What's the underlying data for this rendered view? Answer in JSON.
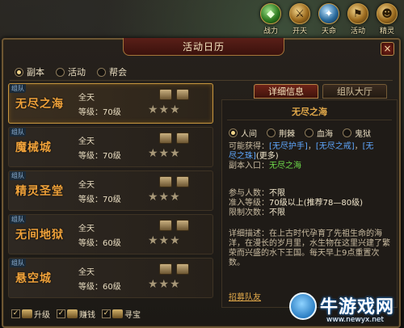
{
  "hud": [
    {
      "label": "战力",
      "icon": "power-icon",
      "glyph": "◆",
      "style": "green"
    },
    {
      "label": "开天",
      "icon": "kaitian-icon",
      "glyph": "⚔",
      "style": ""
    },
    {
      "label": "天命",
      "icon": "destiny-icon",
      "glyph": "✦",
      "style": "blue"
    },
    {
      "label": "活动",
      "icon": "activity-icon",
      "glyph": "⚑",
      "style": ""
    },
    {
      "label": "精灵",
      "icon": "spirit-icon",
      "glyph": "☻",
      "style": ""
    }
  ],
  "window": {
    "title": "活动日历",
    "close": "×"
  },
  "categories": [
    {
      "label": "副本",
      "selected": true
    },
    {
      "label": "活动",
      "selected": false
    },
    {
      "label": "帮会",
      "selected": false
    }
  ],
  "list": [
    {
      "tag": "组队",
      "name": "无尽之海",
      "time": "全天",
      "level": "等级：70级",
      "stars": "★★★",
      "selected": true
    },
    {
      "tag": "组队",
      "name": "魔械城",
      "time": "全天",
      "level": "等级：70级",
      "stars": "★★★",
      "selected": false
    },
    {
      "tag": "组队",
      "name": "精灵圣堂",
      "time": "全天",
      "level": "等级：70级",
      "stars": "★★★",
      "selected": false
    },
    {
      "tag": "组队",
      "name": "无间地狱",
      "time": "全天",
      "level": "等级：60级",
      "stars": "★★★",
      "selected": false
    },
    {
      "tag": "组队",
      "name": "悬空城",
      "time": "全天",
      "level": "等级：60级",
      "stars": "★★★",
      "selected": false
    }
  ],
  "tabs": {
    "detail": "详细信息",
    "team_hall": "组队大厅"
  },
  "detail": {
    "title": "无尽之海",
    "difficulties": [
      {
        "label": "人间",
        "selected": true
      },
      {
        "label": "荆棘",
        "selected": false
      },
      {
        "label": "血海",
        "selected": false
      },
      {
        "label": "鬼狱",
        "selected": false
      }
    ],
    "rewards_label": "可能获得：",
    "reward_1": "[无尽护手]",
    "reward_2": "[无尽之戒]",
    "reward_3a": "[无",
    "reward_3b": "尽之珠]",
    "more": "(更多)",
    "entry_label": "副本入口：",
    "entry_value": "无尽之海",
    "players_label": "参与人数：",
    "players_value": "不限",
    "entry_level_label": "准入等级：",
    "entry_level_value": "70级以上(推荐78—80级)",
    "limit_label": "限制次数：",
    "limit_value": "不限",
    "desc_label": "详细描述：",
    "desc_text": "在上古时代孕育了先祖生命的海洋，在漫长的岁月里，水生物在这里兴建了繁荣而兴盛的水下王国。每天早上9点重置次数。",
    "recruit": "招募队友"
  },
  "filters": [
    {
      "label": "升级",
      "checked": true
    },
    {
      "label": "赚钱",
      "checked": true
    },
    {
      "label": "寻宝",
      "checked": true
    }
  ],
  "watermark": {
    "text": "牛游戏网",
    "url": "www.newyx.net"
  }
}
